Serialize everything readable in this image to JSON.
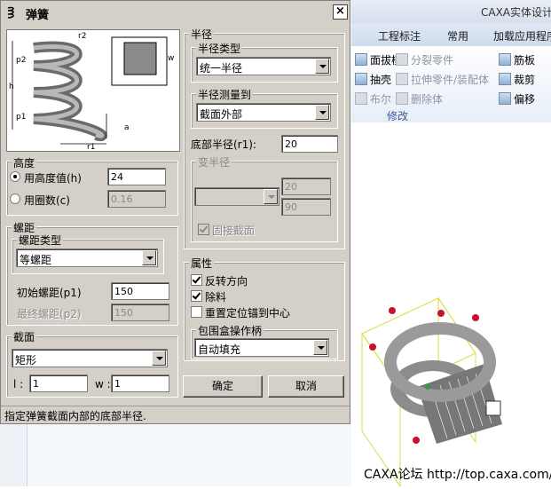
{
  "app": {
    "title": "CAXA实体设计",
    "tabs": [
      "工程标注",
      "常用",
      "加载应用程序"
    ],
    "ribbon": {
      "col1": [
        "面拔模",
        "抽壳",
        "布尔"
      ],
      "col2": [
        "分裂零件",
        "拉伸零件/装配体",
        "删除体"
      ],
      "col3": [
        "筋板",
        "裁剪",
        "偏移"
      ],
      "group_label": "修改"
    },
    "watermark": "CAXA论坛 http://top.caxa.com/"
  },
  "dialog": {
    "title": "弹簧",
    "close": "×",
    "preview": {
      "labels": [
        "r2",
        "p2",
        "w",
        "h",
        "p1",
        "a",
        "r1"
      ]
    },
    "height": {
      "group": "高度",
      "by_height_label": "用高度值(h)",
      "by_height_value": "24",
      "by_turns_label": "用圈数(c)",
      "by_turns_value": "0.16"
    },
    "pitch": {
      "group": "螺距",
      "type_group": "螺距类型",
      "type_value": "等螺距",
      "start_label": "初始螺距(p1)",
      "start_value": "150",
      "end_label": "最终螺距(p2)",
      "end_value": "150"
    },
    "section": {
      "group": "截面",
      "shape_value": "矩形",
      "l_label": "l :",
      "l_value": "1",
      "w_label": "w :",
      "w_value": "1"
    },
    "radius": {
      "group": "半径",
      "type_group": "半径类型",
      "type_value": "统一半径",
      "measure_group": "半径测量到",
      "measure_value": "截面外部",
      "bottom_label": "底部半径(r1):",
      "bottom_value": "20",
      "variable_group": "变半径",
      "var_value1": "20",
      "var_value2": "90",
      "fixed_section_label": "固接截面"
    },
    "props": {
      "group": "属性",
      "reverse_label": "反转方向",
      "remove_label": "除料",
      "reposition_label": "重置定位锚到中心",
      "handle_group": "包围盒操作柄",
      "handle_value": "自动填充"
    },
    "ok": "确定",
    "cancel": "取消",
    "status": "指定弹簧截面内部的底部半径."
  },
  "colors": {
    "dialog_face": "#d4d0c8",
    "accent": "#3b5998"
  }
}
